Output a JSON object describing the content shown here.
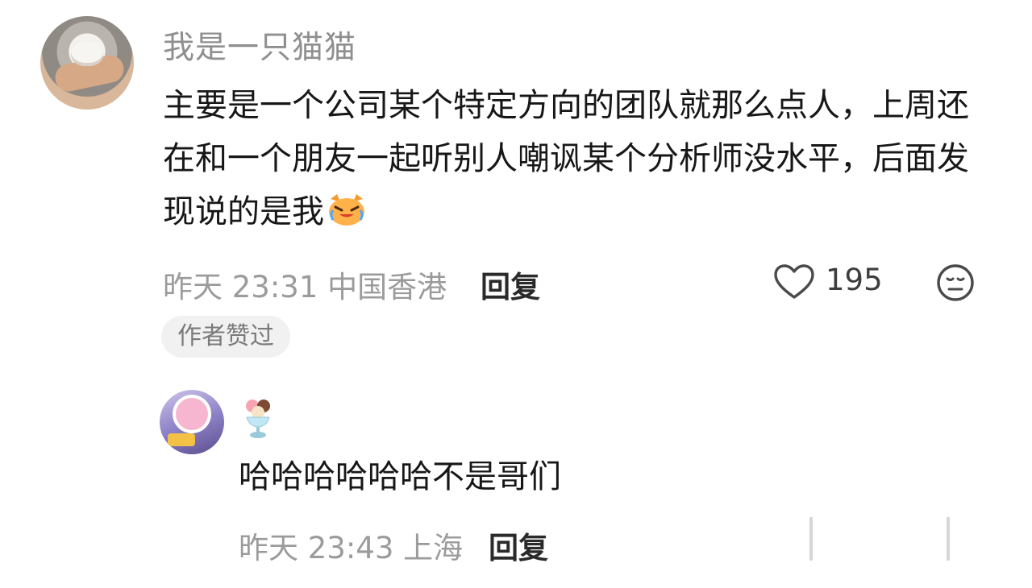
{
  "comment": {
    "username": "我是一只猫猫",
    "content": "主要是一个公司某个特定方向的团队就那么点人，上周还在和一个朋友一起听别人嘲讽某个分析师没水平，后面发现说的是我",
    "emoji": "crying-laughing-cat-icon",
    "meta": "昨天 23:31 中国香港",
    "reply_label": "回复",
    "like_count": "195",
    "author_badge": "作者赞过"
  },
  "reply": {
    "user_icon": "ice-cream-sundae-icon",
    "content": "哈哈哈哈哈哈不是哥们",
    "meta": "昨天 23:43 上海",
    "reply_label": "回复"
  },
  "colors": {
    "text": "#171717",
    "meta": "#9b9b9b",
    "badge_bg": "#f1f1f1"
  }
}
